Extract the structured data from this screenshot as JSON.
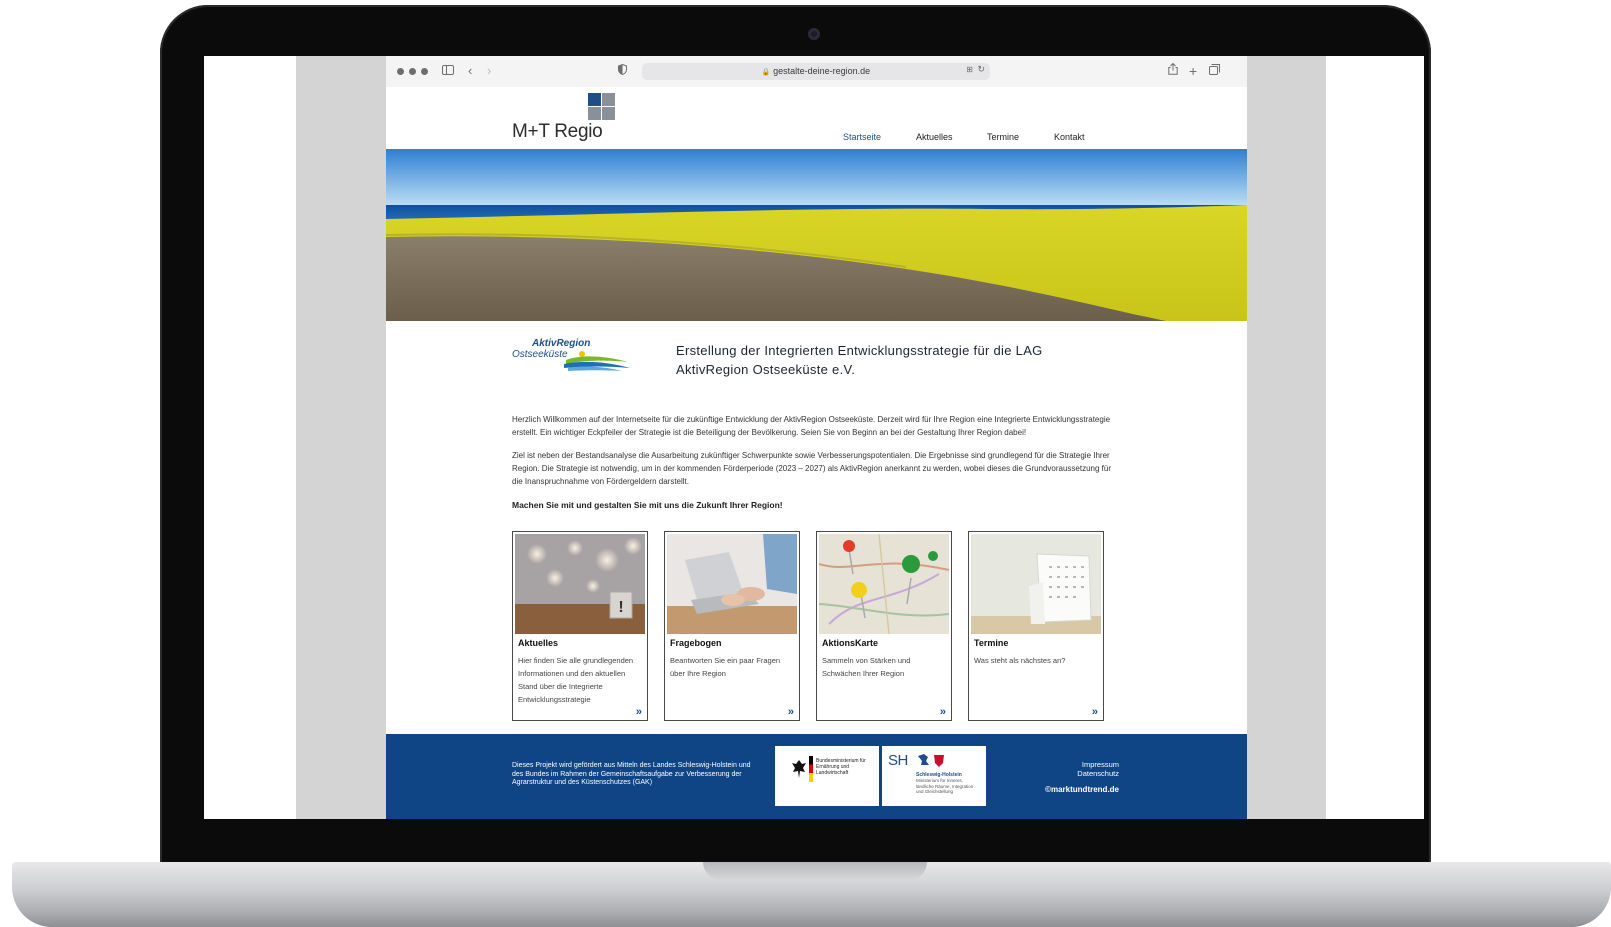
{
  "browser": {
    "url": "gestalte-deine-region.de"
  },
  "site": {
    "logo_text": "M+T Regio",
    "nav": [
      {
        "label": "Startseite"
      },
      {
        "label": "Aktuelles"
      },
      {
        "label": "Termine"
      },
      {
        "label": "Kontakt"
      }
    ]
  },
  "intro": {
    "partner_logo_line1": "AktivRegion",
    "partner_logo_line2": "Ostseeküste",
    "headline": "Erstellung der Integrierten Entwicklungsstrategie für die LAG AktivRegion Ostseeküste e.V.",
    "paragraph1": "Herzlich Willkommen auf der Internetseite für die zukünftige Entwicklung der AktivRegion Ostseeküste. Derzeit wird für Ihre Region eine Integrierte Entwicklungsstrategie erstellt. Ein wichtiger Eckpfeiler der Strategie ist die Beteiligung der Bevölkerung. Seien Sie von Beginn an bei der Gestaltung Ihrer Region dabei!",
    "paragraph2": "Ziel ist neben der Bestandsanalyse die Ausarbeitung zukünftiger Schwerpunkte sowie Verbesserungspotentialen. Die Ergebnisse sind grundlegend für die Strategie Ihrer Region. Die Strategie ist notwendig, um in der kommenden Förderperiode (2023 – 2027) als AktivRegion anerkannt zu werden, wobei dieses die Grundvoraussetzung für die Inanspruchnahme von Fördergeldern darstellt.",
    "cta": "Machen Sie mit und gestalten Sie mit uns die Zukunft Ihrer Region!"
  },
  "cards": [
    {
      "title": "Aktuelles",
      "text": "Hier finden Sie alle grundlegenden Informationen und den aktuellen Stand über die Integrierte Entwicklungsstrategie",
      "arrow": "»"
    },
    {
      "title": "Fragebogen",
      "text": "Beantworten Sie ein paar Fragen über Ihre Region",
      "arrow": "»"
    },
    {
      "title": "AktionsKarte",
      "text": "Sammeln von Stärken und Schwächen Ihrer Region",
      "arrow": "»"
    },
    {
      "title": "Termine",
      "text": "Was steht als nächstes an?",
      "arrow": "»"
    }
  ],
  "footer": {
    "funding_text": "Dieses Projekt wird gefördert aus Mitteln des Landes Schleswig-Holstein und des Bundes im Rahmen der Gemeinschaftsaufgabe zur Verbesserung der Agrarstruktur und des Küstenschutzes (GAK)",
    "bmel_text": "Bundesministerium für Ernährung und Landwirtschaft",
    "sh_abbr": "SH",
    "sh_name": "Schleswig-Holstein",
    "sh_ministry": "Ministerium für Inneres, ländliche Räume, Integration und Gleichstellung",
    "impressum": "Impressum",
    "datenschutz": "Datenschutz",
    "copyright": "©marktundtrend.de"
  },
  "colors": {
    "brand_blue": "#0f4585",
    "nav_active": "#1e4f8c",
    "logo_dark_blue": "#1f4e86",
    "logo_gray": "#8a9099"
  }
}
